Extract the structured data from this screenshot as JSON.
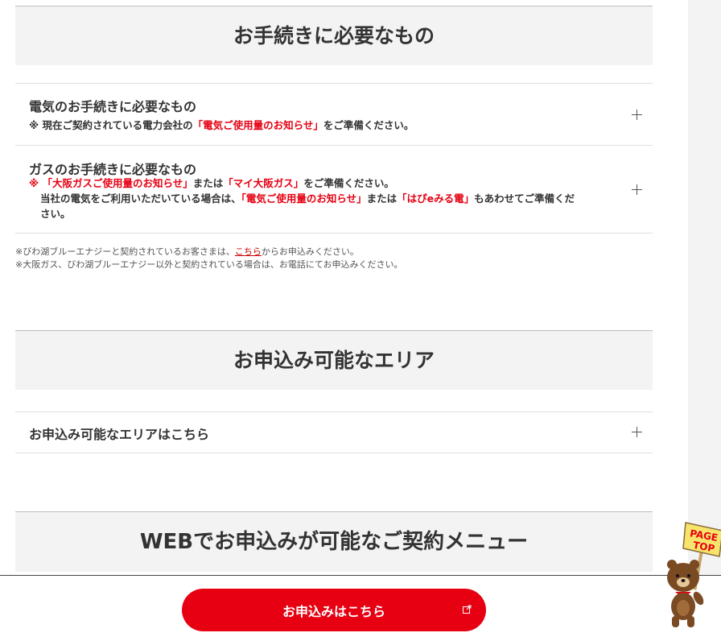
{
  "sections": {
    "required": {
      "heading": "お手続きに必要なもの",
      "electric": {
        "title": "電気のお手続きに必要なもの",
        "note_prefix": "※ 現在ご契約されている電力会社の",
        "note_red": "「電気ご使用量のお知らせ」",
        "note_suffix": "をご準備ください。"
      },
      "gas": {
        "title": "ガスのお手続きに必要なもの",
        "line1_mark": "※",
        "line1_red1": "「大阪ガスご使用量のお知らせ」",
        "line1_mid": "または",
        "line1_red2": "「マイ大阪ガス」",
        "line1_suffix": "をご準備ください。",
        "line2_prefix": "当社の電気をご利用いただいている場合は、",
        "line2_red1": "「電気ご使用量のお知らせ」",
        "line2_mid": "または",
        "line2_red2": "「はぴeみる電」",
        "line2_suffix": "もあわせてご準備くだ",
        "line3": "さい。"
      },
      "notes": {
        "note1_prefix": "※びわ湖ブルーエナジーと契約されているお客さまは、",
        "note1_link": "こちら",
        "note1_suffix": "からお申込みください。",
        "note2": "※大阪ガス、びわ湖ブルーエナジー以外と契約されている場合は、お電話にてお申込みください。"
      }
    },
    "area": {
      "heading": "お申込み可能なエリア",
      "item_title": "お申込み可能なエリアはこちら"
    },
    "web": {
      "heading": "WEBでお申込みが可能なご契約メニュー"
    }
  },
  "footer": {
    "apply_button": "お申込みはこちら"
  },
  "pagetop": {
    "line1": "PAGE",
    "line2": "TOP"
  },
  "colors": {
    "accent": "#e60012",
    "heading_bg": "#f3f3f3"
  }
}
